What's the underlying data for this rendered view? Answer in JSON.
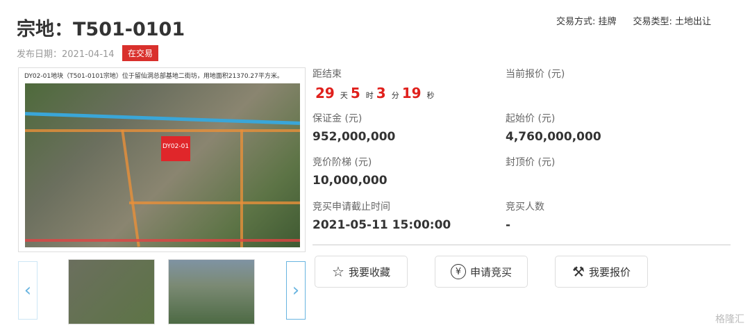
{
  "title": "宗地：T501-0101",
  "trade_method": "交易方式: 挂牌",
  "trade_type": "交易类型: 土地出让",
  "publish_date": "发布日期：2021-04-14",
  "status": "在交易",
  "image": {
    "caption": "DY02-01地块（T501-0101宗地）位于留仙洞总部基地二街坊，用地面积21370.27平方米。",
    "plot_label": "DY02-01"
  },
  "countdown": {
    "label": "距结束",
    "days": "29",
    "days_unit": "天",
    "hours": "5",
    "hours_unit": "时",
    "minutes": "3",
    "minutes_unit": "分",
    "seconds": "19",
    "seconds_unit": "秒"
  },
  "fields": {
    "current_price_label": "当前报价 (元)",
    "current_price": "",
    "deposit_label": "保证金 (元)",
    "deposit": "952,000,000",
    "start_price_label": "起始价 (元)",
    "start_price": "4,760,000,000",
    "step_label": "竞价阶梯 (元)",
    "step": "10,000,000",
    "cap_price_label": "封顶价 (元)",
    "deadline_label": "竞买申请截止时间",
    "deadline": "2021-05-11 15:00:00",
    "bidders_label": "竞买人数",
    "bidders": "-"
  },
  "buttons": {
    "favorite": "我要收藏",
    "apply": "申请竞买",
    "bid": "我要报价"
  },
  "watermark": "格隆汇"
}
